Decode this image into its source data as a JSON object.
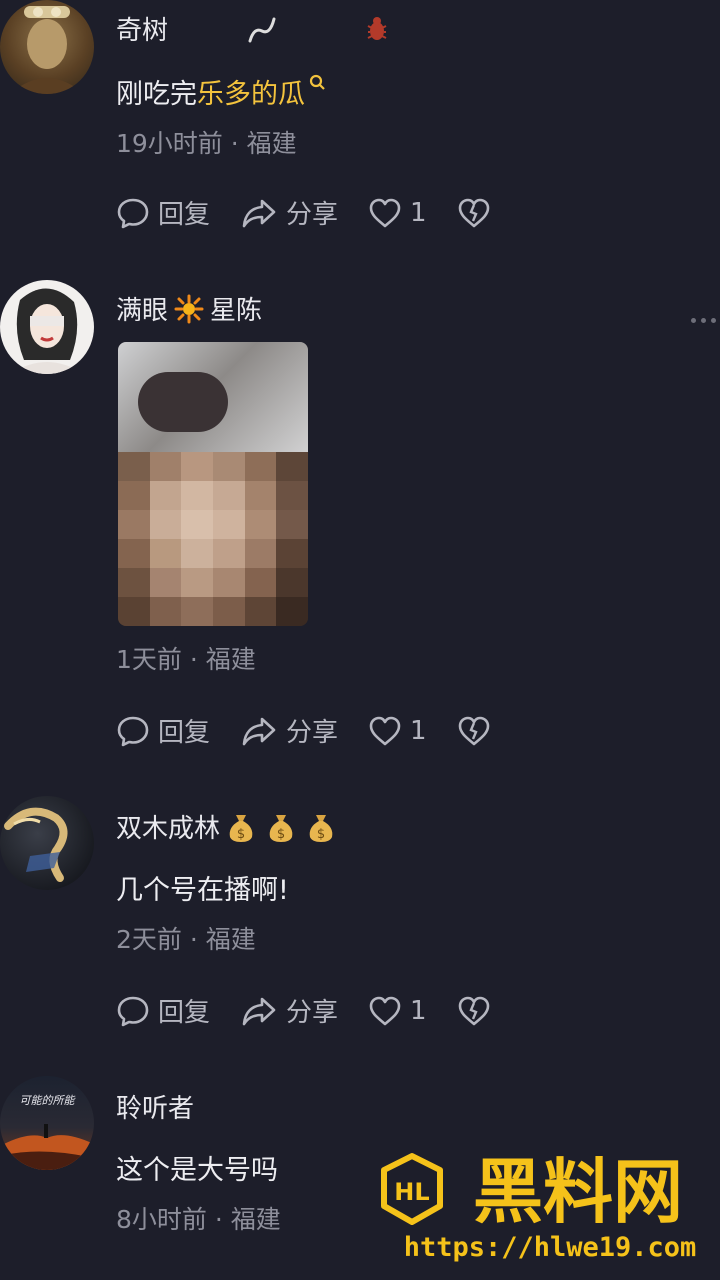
{
  "comments": [
    {
      "username": "奇树",
      "text_prefix": "刚吃完",
      "text_link": "乐多的瓜",
      "meta": "19小时前 · 福建",
      "reply_label": "回复",
      "share_label": "分享",
      "like_count": "1"
    },
    {
      "username_a": "满眼",
      "username_b": "星陈",
      "meta": "1天前 · 福建",
      "reply_label": "回复",
      "share_label": "分享",
      "like_count": "1"
    },
    {
      "username": "双木成林",
      "text": "几个号在播啊!",
      "meta": "2天前 · 福建",
      "reply_label": "回复",
      "share_label": "分享",
      "like_count": "1"
    },
    {
      "username": "聆听者",
      "text": "这个是大号吗",
      "meta": "8小时前 · 福建",
      "avatar_caption": "可能的所能"
    }
  ],
  "watermark": {
    "logo": "HL",
    "brand": "黑料网",
    "url": "https://hlwe19.com"
  },
  "colors": {
    "background": "#1d1e2a",
    "highlight": "#f3c33d",
    "watermark": "#f5c21a"
  }
}
